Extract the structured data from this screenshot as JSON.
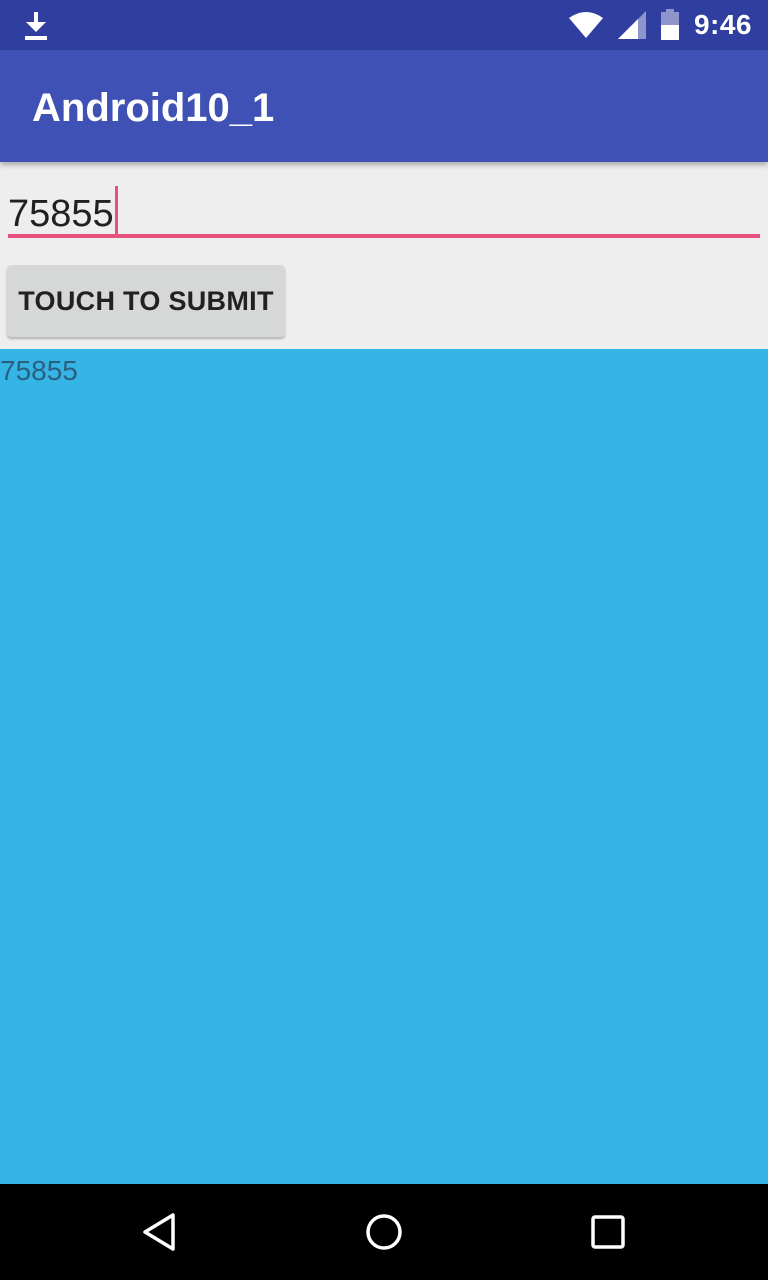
{
  "status_bar": {
    "time": "9:46",
    "left_icon": "download-icon",
    "right_icons": [
      "wifi-icon",
      "cellular-signal-icon",
      "battery-icon"
    ]
  },
  "app_bar": {
    "title": "Android10_1",
    "color": "#3f51b5"
  },
  "form": {
    "input_value": "75855",
    "submit_label": "TOUCH TO SUBMIT",
    "accent_color": "#e8507d"
  },
  "output": {
    "text": "75855",
    "background_color": "#35b5e5"
  },
  "nav_bar": {
    "icons": [
      "back-icon",
      "home-icon",
      "recents-icon"
    ]
  }
}
